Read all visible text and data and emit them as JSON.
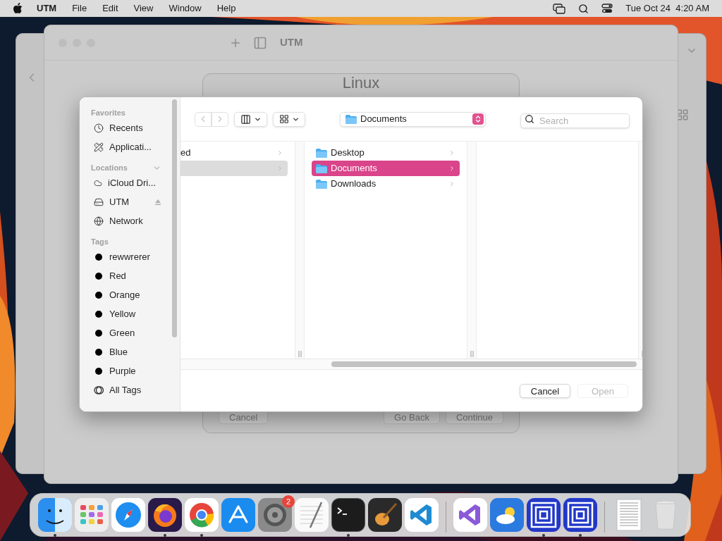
{
  "menu_bar": {
    "app": "UTM",
    "menus": [
      "File",
      "Edit",
      "View",
      "Window",
      "Help"
    ],
    "clock": "Tue Oct 24  4:20 AM"
  },
  "utm_window": {
    "title": "UTM"
  },
  "wizard": {
    "title": "Linux",
    "buttons": [
      "Cancel",
      "Go Back",
      "Continue"
    ]
  },
  "open_panel": {
    "sidebar": [
      {
        "heading": "Favorites",
        "items": [
          {
            "kind": "clock",
            "label": "Recents"
          },
          {
            "kind": "apps",
            "label": "Applicati..."
          }
        ]
      },
      {
        "heading": "Locations",
        "items": [
          {
            "kind": "cloud",
            "label": "iCloud Dri..."
          },
          {
            "kind": "drive",
            "label": "UTM",
            "eject": true
          },
          {
            "kind": "network",
            "label": "Network"
          }
        ]
      },
      {
        "heading": "Tags",
        "items": [
          {
            "kind": "tag",
            "label": "rewwrerer"
          },
          {
            "kind": "tag",
            "label": "Red"
          },
          {
            "kind": "tag",
            "label": "Orange"
          },
          {
            "kind": "tag",
            "label": "Yellow"
          },
          {
            "kind": "tag",
            "label": "Green"
          },
          {
            "kind": "tag",
            "label": "Blue"
          },
          {
            "kind": "tag",
            "label": "Purple"
          },
          {
            "kind": "alltags",
            "label": "All Tags"
          }
        ]
      }
    ],
    "toolbar": {
      "back_disabled": true,
      "forward_disabled": true,
      "path": "Documents",
      "search": {
        "placeholder": "Search"
      }
    },
    "columns": [
      [
        {
          "label": "ed",
          "selected": false
        },
        {
          "selected": true
        }
      ],
      [
        {
          "label": "Desktop",
          "selected": false
        },
        {
          "label": "Documents",
          "selected": true
        },
        {
          "label": "Downloads",
          "selected": false
        }
      ],
      []
    ],
    "buttons": [
      {
        "label": "Cancel",
        "disabled": false
      },
      {
        "label": "Open",
        "disabled": true
      }
    ]
  },
  "dock": [
    {
      "kind": "finder",
      "running": true
    },
    {
      "kind": "launchpad",
      "running": false
    },
    {
      "kind": "safari",
      "running": false
    },
    {
      "kind": "firefox",
      "running": true
    },
    {
      "kind": "chrome",
      "running": true
    },
    {
      "kind": "appstore",
      "running": false
    },
    {
      "kind": "settings",
      "running": false,
      "badge": "2"
    },
    {
      "kind": "textedit",
      "running": false
    },
    {
      "kind": "terminal",
      "running": true
    },
    {
      "kind": "garageband",
      "running": false
    },
    {
      "kind": "vscode",
      "running": false
    },
    {
      "kind": "separator"
    },
    {
      "kind": "visualstudio",
      "running": false
    },
    {
      "kind": "weather",
      "running": false
    },
    {
      "kind": "utm",
      "running": true
    },
    {
      "kind": "utm",
      "running": true
    },
    {
      "kind": "separator"
    },
    {
      "kind": "document",
      "running": false
    },
    {
      "kind": "trash",
      "running": false
    }
  ]
}
